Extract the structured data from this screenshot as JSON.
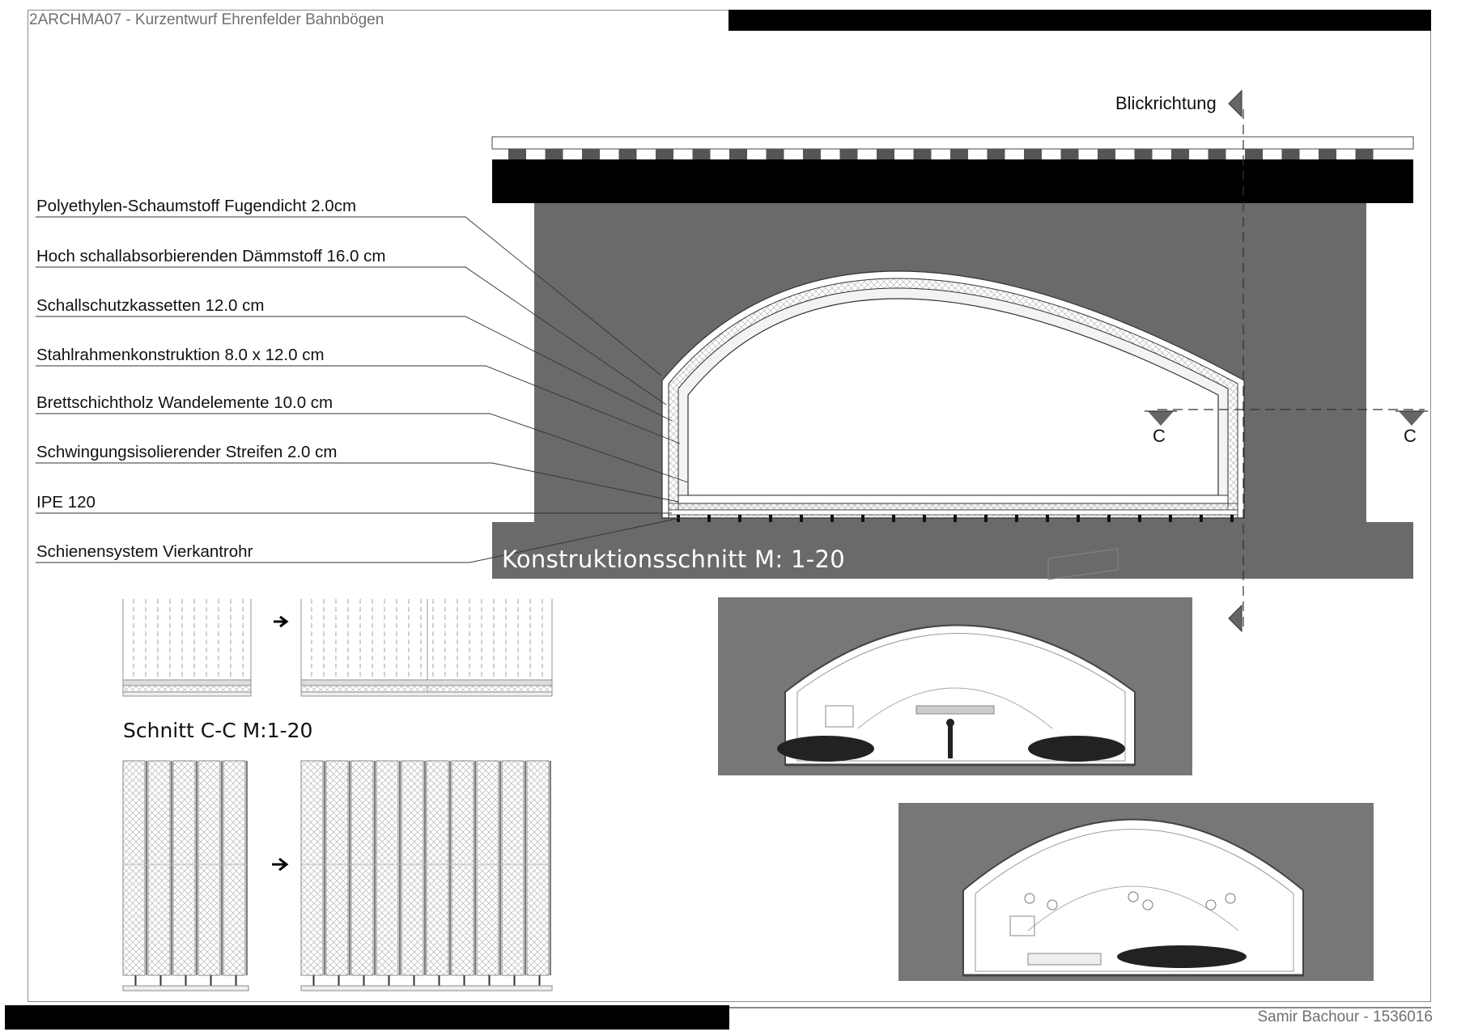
{
  "header": {
    "title": "2ARCHMA07 - Kurzentwurf Ehrenfelder Bahnbögen"
  },
  "footer": {
    "author": "Samir Bachour - 1536016"
  },
  "section": {
    "title": "Konstruktionsschnitt M: 1-20",
    "view_direction": "Blickrichtung",
    "cut_marker_left": "C",
    "cut_marker_right": "C"
  },
  "callouts": [
    "Polyethylen-Schaumstoff Fugendicht 2.0cm",
    "Hoch schallabsorbierenden Dämmstoff 16.0 cm",
    "Schallschutzkassetten 12.0 cm",
    "Stahlrahmenkonstruktion 8.0 x 12.0 cm",
    "Brettschichtholz Wandelemente 10.0 cm",
    "Schwingungsisolierender Streifen 2.0 cm",
    "IPE 120",
    "Schienensystem Vierkantrohr"
  ],
  "detail": {
    "title": "Schnitt C-C M:1-20"
  },
  "colors": {
    "wall": "#6a6a6a",
    "slab": "#000000",
    "render_bg": "#777777"
  }
}
